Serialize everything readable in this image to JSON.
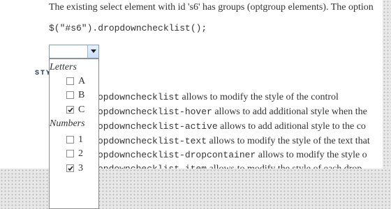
{
  "intro": "The existing select element with id 's6' has groups (optgroup elements). The option",
  "code": "$(\"#s6\").dropdownchecklist();",
  "styles_heading": "STY",
  "style_rows": [
    {
      "class_name": "opdownchecklist",
      "description": "allows to modify the style of the control"
    },
    {
      "class_name": "opdownchecklist-hover",
      "description": "allows to add additional style when the"
    },
    {
      "class_name": "opdownchecklist-active",
      "description": "allows to add aditional style to the co"
    },
    {
      "class_name": "opdownchecklist-text",
      "description": "allows to modify the style of the text that"
    },
    {
      "class_name": "opdownchecklist-dropcontainer",
      "description": "allows to modify the style o"
    },
    {
      "class_name": "opdownchecklist-item",
      "description": "allows to modify the style of each drop"
    }
  ],
  "dropdown": {
    "groups": [
      {
        "label": "Letters",
        "options": [
          {
            "label": "A",
            "checked": false
          },
          {
            "label": "B",
            "checked": false
          },
          {
            "label": "C",
            "checked": true
          }
        ]
      },
      {
        "label": "Numbers",
        "options": [
          {
            "label": "1",
            "checked": false
          },
          {
            "label": "2",
            "checked": false
          },
          {
            "label": "3",
            "checked": true
          }
        ]
      }
    ]
  },
  "icons": {
    "select_arrow": "chevron-down-icon",
    "checkmark": "checkmark-icon"
  },
  "colors": {
    "text": "#333333",
    "heading": "#1f3659",
    "select_border": "#7e9db9",
    "background_pattern": "#e7e7e7"
  }
}
